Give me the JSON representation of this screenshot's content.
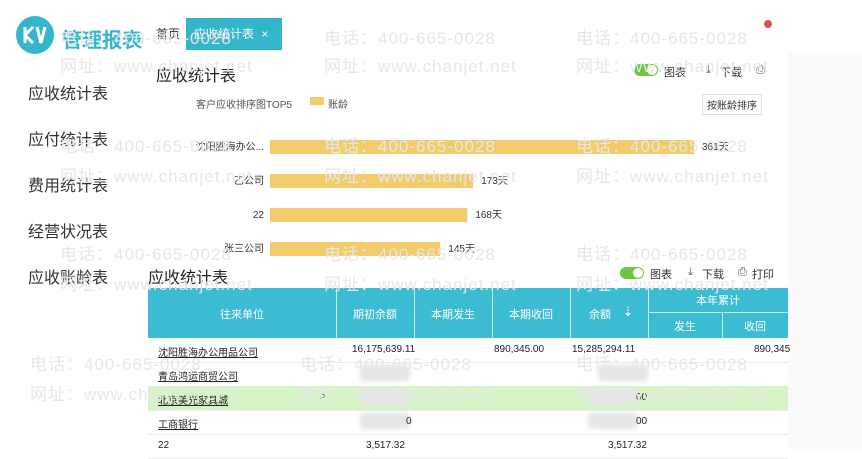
{
  "app": {
    "brand": "管理报表"
  },
  "sidebar": {
    "items": [
      "应收统计表",
      "应付统计表",
      "费用统计表",
      "经营状况表",
      "应收账龄表"
    ]
  },
  "tabs": {
    "home": "首页",
    "active": "应收统计表",
    "close": "×"
  },
  "watermark": {
    "phone": "电话：400-665-0028",
    "site": "网址：www.chanjet.net"
  },
  "upper": {
    "title": "应收统计表",
    "toggle_label": "图表",
    "download": "下载",
    "print_icon": "printer-icon",
    "chart_caption": "客户应收排序图TOP5",
    "sort_button": "按账龄排序"
  },
  "chart_data": {
    "type": "bar",
    "orientation": "horizontal",
    "title": "客户应收排序图TOP5",
    "legend": [
      "账龄"
    ],
    "categories": [
      "沈阳胜海办公...",
      "乙公司",
      "22",
      "张三公司"
    ],
    "values": [
      361,
      173,
      168,
      145
    ],
    "data_labels": [
      "361天",
      "173天",
      "168天",
      "145天"
    ],
    "color": "#f2cc6b"
  },
  "lower": {
    "title": "应收统计表",
    "toggle_label": "图表",
    "download": "下载",
    "print": "打印",
    "headers": {
      "unit": "往来单位",
      "opening": "期初余额",
      "current_occur": "本期发生",
      "current_recv": "本期收回",
      "balance": "余额",
      "year_total": "本年累计",
      "year_occur": "发生",
      "year_recv": "收回"
    },
    "rows": [
      {
        "unit": "沈阳胜海办公用品公司",
        "opening": "16,175,639.11",
        "current_recv": "890,345.00",
        "balance": "15,285,294.11",
        "year_recv": "890,345"
      },
      {
        "unit": "青岛鸿运商贸公司",
        "opening": "",
        "current_recv": "",
        "balance": "",
        "year_recv": ""
      },
      {
        "unit": "北京美光家具城",
        "opening": "",
        "current_recv": "",
        "balance": "00",
        "year_recv": ""
      },
      {
        "unit": "工商银行",
        "opening": "0",
        "current_recv": "",
        "balance": "00",
        "year_recv": ""
      },
      {
        "unit": "22",
        "opening": "3,517.32",
        "current_recv": "",
        "balance": "3,517.32",
        "year_recv": ""
      }
    ]
  }
}
